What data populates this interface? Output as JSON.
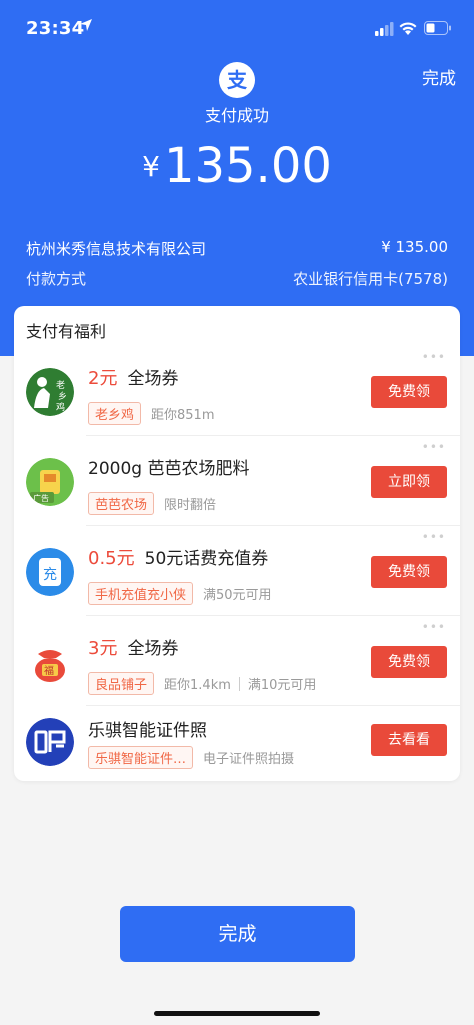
{
  "status_bar": {
    "time": "23:34"
  },
  "header": {
    "done_label": "完成",
    "logo_glyph": "支",
    "title": "支付成功",
    "currency": "¥",
    "amount": "135.00"
  },
  "details": {
    "merchant": "杭州米秀信息技术有限公司",
    "merchant_amount": "¥ 135.00",
    "payment_label": "付款方式",
    "payment_value": "农业银行信用卡(7578)"
  },
  "benefits": {
    "title": "支付有福利",
    "items": [
      {
        "value": "2元",
        "title": "全场券",
        "tag": "老乡鸡",
        "desc": "距你851m",
        "desc2": "",
        "button": "免费领",
        "icon": "laoxiangji-logo-icon"
      },
      {
        "value": "",
        "title": "2000g 芭芭农场肥料",
        "tag": "芭芭农场",
        "desc": "限时翻倍",
        "desc2": "",
        "button": "立即领",
        "icon": "fertilizer-ad-icon"
      },
      {
        "value": "0.5元",
        "title": "50元话费充值券",
        "tag": "手机充值充小侠",
        "desc": "满50元可用",
        "desc2": "",
        "button": "免费领",
        "icon": "recharge-icon"
      },
      {
        "value": "3元",
        "title": "全场券",
        "tag": "良品铺子",
        "desc": "距你1.4km",
        "desc2": "满10元可用",
        "button": "免费领",
        "icon": "lucky-bag-icon"
      },
      {
        "value": "",
        "title": "乐骐智能证件照",
        "tag": "乐骐智能证件…",
        "desc": "电子证件照拍摄",
        "desc2": "",
        "button": "去看看",
        "icon": "photo-id-icon"
      }
    ]
  },
  "footer": {
    "done_button": "完成"
  },
  "colors": {
    "brand_blue": "#2f6df3",
    "accent_red": "#e94a3a"
  }
}
